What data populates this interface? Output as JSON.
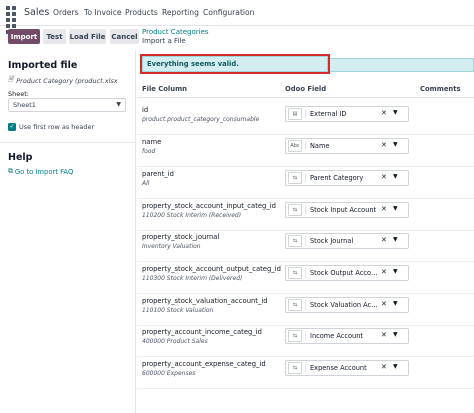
{
  "topbar": {
    "app_name": "Sales",
    "menu": [
      "Orders",
      "To Invoice",
      "Products",
      "Reporting",
      "Configuration"
    ]
  },
  "controls": {
    "import_label": "Import",
    "test_label": "Test",
    "load_file_label": "Load File",
    "cancel_label": "Cancel",
    "breadcrumb_parent": "Product Categories",
    "breadcrumb_current": "Import a File"
  },
  "sidebar": {
    "imported_file_title": "Imported file",
    "file_name": "Product Category (product.xlsx",
    "sheet_label": "Sheet:",
    "sheet_value": "Sheet1",
    "first_row_header_label": "Use first row as header",
    "first_row_header_checked": true,
    "help_title": "Help",
    "faq_link": "Go to Import FAQ"
  },
  "alert": {
    "message": "Everything seems valid."
  },
  "table": {
    "headers": {
      "file_column": "File Column",
      "odoo_field": "Odoo Field",
      "comments": "Comments"
    },
    "rows": [
      {
        "column": "id",
        "sample": "product.product_category_consumable",
        "field": "External ID",
        "icon": "document-icon",
        "glyph": "▤"
      },
      {
        "column": "name",
        "sample": "food",
        "field": "Name",
        "icon": "text-abc-icon",
        "glyph": "Abc"
      },
      {
        "column": "parent_id",
        "sample": "All",
        "field": "Parent Category",
        "icon": "relation-icon",
        "glyph": "⇆"
      },
      {
        "column": "property_stock_account_input_categ_id",
        "sample": "110200 Stock Interim (Received)",
        "field": "Stock Input Account",
        "icon": "relation-icon",
        "glyph": "⇆"
      },
      {
        "column": "property_stock_journal",
        "sample": "Inventory Valuation",
        "field": "Stock Journal",
        "icon": "relation-icon",
        "glyph": "⇆"
      },
      {
        "column": "property_stock_account_output_categ_id",
        "sample": "110300 Stock Interim (Delivered)",
        "field": "Stock Output Accou...",
        "icon": "relation-icon",
        "glyph": "⇆"
      },
      {
        "column": "property_stock_valuation_account_id",
        "sample": "110100 Stock Valuation",
        "field": "Stock Valuation Ac...",
        "icon": "relation-icon",
        "glyph": "⇆"
      },
      {
        "column": "property_account_income_categ_id",
        "sample": "400000 Product Sales",
        "field": "Income Account",
        "icon": "relation-icon",
        "glyph": "⇆"
      },
      {
        "column": "property_account_expense_categ_id",
        "sample": "600000 Expenses",
        "field": "Expense Account",
        "icon": "relation-icon",
        "glyph": "⇆"
      }
    ]
  },
  "colors": {
    "brand": "#714b67",
    "link": "#017e84",
    "alert_bg": "#d2eef0",
    "highlight_border": "#d62b2b"
  }
}
